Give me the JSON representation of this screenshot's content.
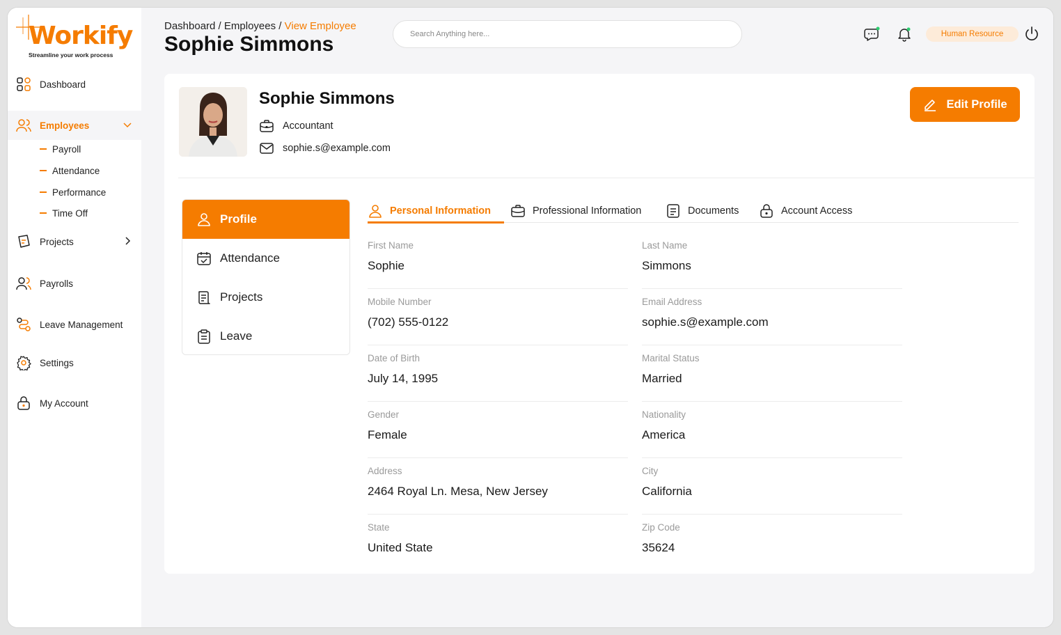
{
  "brand": {
    "name": "Workify",
    "tagline": "Streamline your work process"
  },
  "sidebar": {
    "items": [
      {
        "label": "Dashboard",
        "icon": "grid-icon"
      },
      {
        "label": "Employees",
        "icon": "users-icon",
        "active": true,
        "expanded": true,
        "children": [
          "Payroll",
          "Attendance",
          "Performance",
          "Time Off"
        ]
      },
      {
        "label": "Projects",
        "icon": "projects-icon"
      },
      {
        "label": "Payrolls",
        "icon": "users-icon"
      },
      {
        "label": "Leave Management",
        "icon": "route-icon"
      },
      {
        "label": "Settings",
        "icon": "gear-icon"
      },
      {
        "label": "My Account",
        "icon": "lock-icon"
      }
    ]
  },
  "header": {
    "breadcrumb": {
      "first": "Dashboard",
      "sep1": " / ",
      "second": "Employees",
      "sep2": " / ",
      "current": "View Employee"
    },
    "title": "Sophie Simmons",
    "search_placeholder": "Search Anything here...",
    "role": "Human Resource"
  },
  "employee": {
    "name": "Sophie Simmons",
    "role": "Accountant",
    "email": "sophie.s@example.com",
    "edit_label": "Edit Profile"
  },
  "side_tabs": [
    "Profile",
    "Attendance",
    "Projects",
    "Leave"
  ],
  "tabs": [
    "Personal Information",
    "Professional Information",
    "Documents",
    "Account Access"
  ],
  "fields": [
    {
      "label": "First Name",
      "value": "Sophie"
    },
    {
      "label": "Last Name",
      "value": "Simmons"
    },
    {
      "label": "Mobile Number",
      "value": "(702) 555-0122"
    },
    {
      "label": "Email Address",
      "value": "sophie.s@example.com"
    },
    {
      "label": "Date of Birth",
      "value": "July 14, 1995"
    },
    {
      "label": "Marital Status",
      "value": "Married"
    },
    {
      "label": "Gender",
      "value": "Female"
    },
    {
      "label": "Nationality",
      "value": "America"
    },
    {
      "label": "Address",
      "value": "2464 Royal Ln. Mesa, New Jersey"
    },
    {
      "label": "City",
      "value": "California"
    },
    {
      "label": "State",
      "value": "United State"
    },
    {
      "label": "Zip Code",
      "value": "35624"
    }
  ],
  "colors": {
    "accent": "#f57c00",
    "accent_soft": "#fdebd9",
    "background": "#f5f5f7"
  }
}
